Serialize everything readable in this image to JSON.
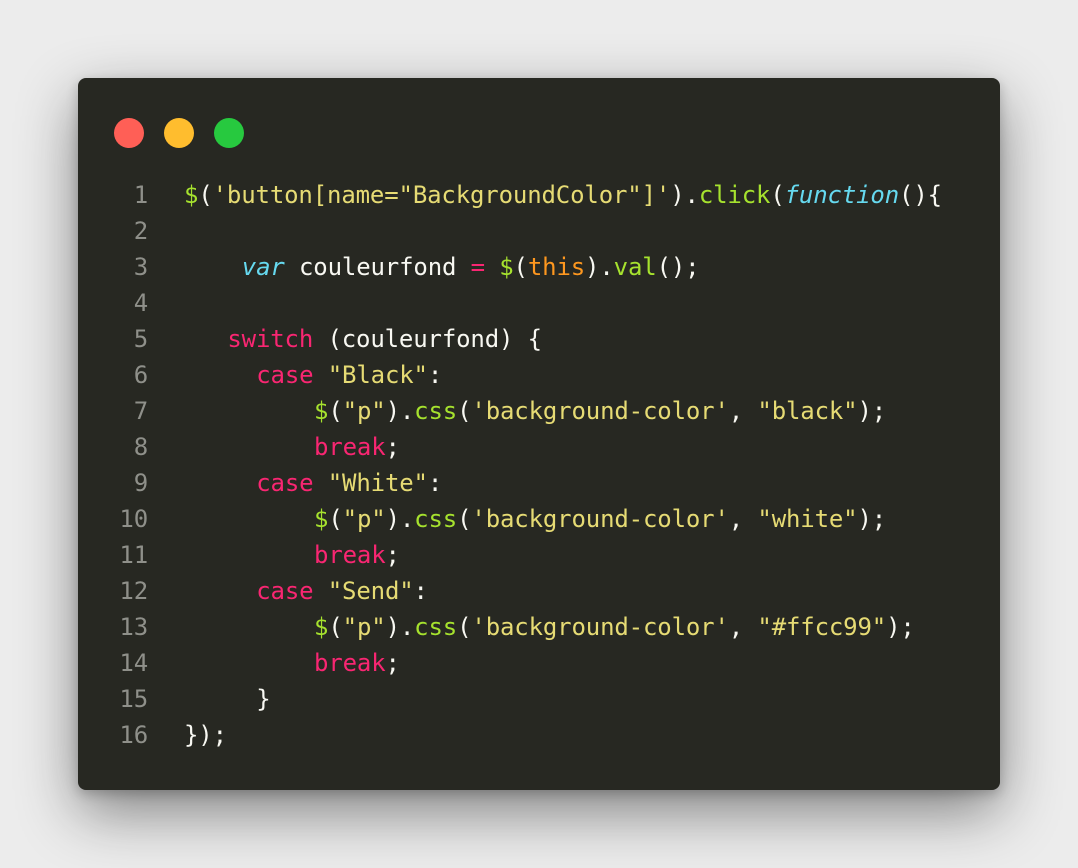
{
  "window": {
    "controls": {
      "close_color": "#ff5f56",
      "minimize_color": "#ffbd2e",
      "zoom_color": "#27c93f"
    }
  },
  "editor": {
    "theme": {
      "background": "#272822",
      "plain": "#f8f8f2",
      "string": "#e6db74",
      "function": "#a6e22e",
      "keyword": "#f92672",
      "storage": "#66d9ef",
      "this": "#fd971f",
      "line_number": "#8f908a"
    },
    "lines": [
      {
        "number": "1",
        "indent": 0,
        "tokens": [
          {
            "text": "$",
            "type": "function"
          },
          {
            "text": "(",
            "type": "plain"
          },
          {
            "text": "'button[name=\"BackgroundColor\"]'",
            "type": "string"
          },
          {
            "text": ").",
            "type": "plain"
          },
          {
            "text": "click",
            "type": "function"
          },
          {
            "text": "(",
            "type": "plain"
          },
          {
            "text": "function",
            "type": "storage-italic"
          },
          {
            "text": "(){",
            "type": "plain"
          }
        ]
      },
      {
        "number": "2",
        "indent": 0,
        "tokens": []
      },
      {
        "number": "3",
        "indent": 4,
        "tokens": [
          {
            "text": "var",
            "type": "storage-italic"
          },
          {
            "text": " couleurfond ",
            "type": "plain"
          },
          {
            "text": "=",
            "type": "keyword"
          },
          {
            "text": " ",
            "type": "plain"
          },
          {
            "text": "$",
            "type": "function"
          },
          {
            "text": "(",
            "type": "plain"
          },
          {
            "text": "this",
            "type": "this"
          },
          {
            "text": ").",
            "type": "plain"
          },
          {
            "text": "val",
            "type": "function"
          },
          {
            "text": "();",
            "type": "plain"
          }
        ]
      },
      {
        "number": "4",
        "indent": 0,
        "tokens": []
      },
      {
        "number": "5",
        "indent": 3,
        "tokens": [
          {
            "text": "switch",
            "type": "keyword"
          },
          {
            "text": " (couleurfond) {",
            "type": "plain"
          }
        ]
      },
      {
        "number": "6",
        "indent": 5,
        "tokens": [
          {
            "text": "case",
            "type": "keyword"
          },
          {
            "text": " ",
            "type": "plain"
          },
          {
            "text": "\"Black\"",
            "type": "string"
          },
          {
            "text": ":",
            "type": "plain"
          }
        ]
      },
      {
        "number": "7",
        "indent": 9,
        "tokens": [
          {
            "text": "$",
            "type": "function"
          },
          {
            "text": "(",
            "type": "plain"
          },
          {
            "text": "\"p\"",
            "type": "string"
          },
          {
            "text": ").",
            "type": "plain"
          },
          {
            "text": "css",
            "type": "function"
          },
          {
            "text": "(",
            "type": "plain"
          },
          {
            "text": "'background-color'",
            "type": "string"
          },
          {
            "text": ", ",
            "type": "plain"
          },
          {
            "text": "\"black\"",
            "type": "string"
          },
          {
            "text": ");",
            "type": "plain"
          }
        ]
      },
      {
        "number": "8",
        "indent": 9,
        "tokens": [
          {
            "text": "break",
            "type": "keyword"
          },
          {
            "text": ";",
            "type": "plain"
          }
        ]
      },
      {
        "number": "9",
        "indent": 5,
        "tokens": [
          {
            "text": "case",
            "type": "keyword"
          },
          {
            "text": " ",
            "type": "plain"
          },
          {
            "text": "\"White\"",
            "type": "string"
          },
          {
            "text": ":",
            "type": "plain"
          }
        ]
      },
      {
        "number": "10",
        "indent": 9,
        "tokens": [
          {
            "text": "$",
            "type": "function"
          },
          {
            "text": "(",
            "type": "plain"
          },
          {
            "text": "\"p\"",
            "type": "string"
          },
          {
            "text": ").",
            "type": "plain"
          },
          {
            "text": "css",
            "type": "function"
          },
          {
            "text": "(",
            "type": "plain"
          },
          {
            "text": "'background-color'",
            "type": "string"
          },
          {
            "text": ", ",
            "type": "plain"
          },
          {
            "text": "\"white\"",
            "type": "string"
          },
          {
            "text": ");",
            "type": "plain"
          }
        ]
      },
      {
        "number": "11",
        "indent": 9,
        "tokens": [
          {
            "text": "break",
            "type": "keyword"
          },
          {
            "text": ";",
            "type": "plain"
          }
        ]
      },
      {
        "number": "12",
        "indent": 5,
        "tokens": [
          {
            "text": "case",
            "type": "keyword"
          },
          {
            "text": " ",
            "type": "plain"
          },
          {
            "text": "\"Send\"",
            "type": "string"
          },
          {
            "text": ":",
            "type": "plain"
          }
        ]
      },
      {
        "number": "13",
        "indent": 9,
        "tokens": [
          {
            "text": "$",
            "type": "function"
          },
          {
            "text": "(",
            "type": "plain"
          },
          {
            "text": "\"p\"",
            "type": "string"
          },
          {
            "text": ").",
            "type": "plain"
          },
          {
            "text": "css",
            "type": "function"
          },
          {
            "text": "(",
            "type": "plain"
          },
          {
            "text": "'background-color'",
            "type": "string"
          },
          {
            "text": ", ",
            "type": "plain"
          },
          {
            "text": "\"#ffcc99\"",
            "type": "string"
          },
          {
            "text": ");",
            "type": "plain"
          }
        ]
      },
      {
        "number": "14",
        "indent": 9,
        "tokens": [
          {
            "text": "break",
            "type": "keyword"
          },
          {
            "text": ";",
            "type": "plain"
          }
        ]
      },
      {
        "number": "15",
        "indent": 5,
        "tokens": [
          {
            "text": "}",
            "type": "plain"
          }
        ]
      },
      {
        "number": "16",
        "indent": 0,
        "tokens": [
          {
            "text": "});",
            "type": "plain"
          }
        ]
      }
    ]
  }
}
